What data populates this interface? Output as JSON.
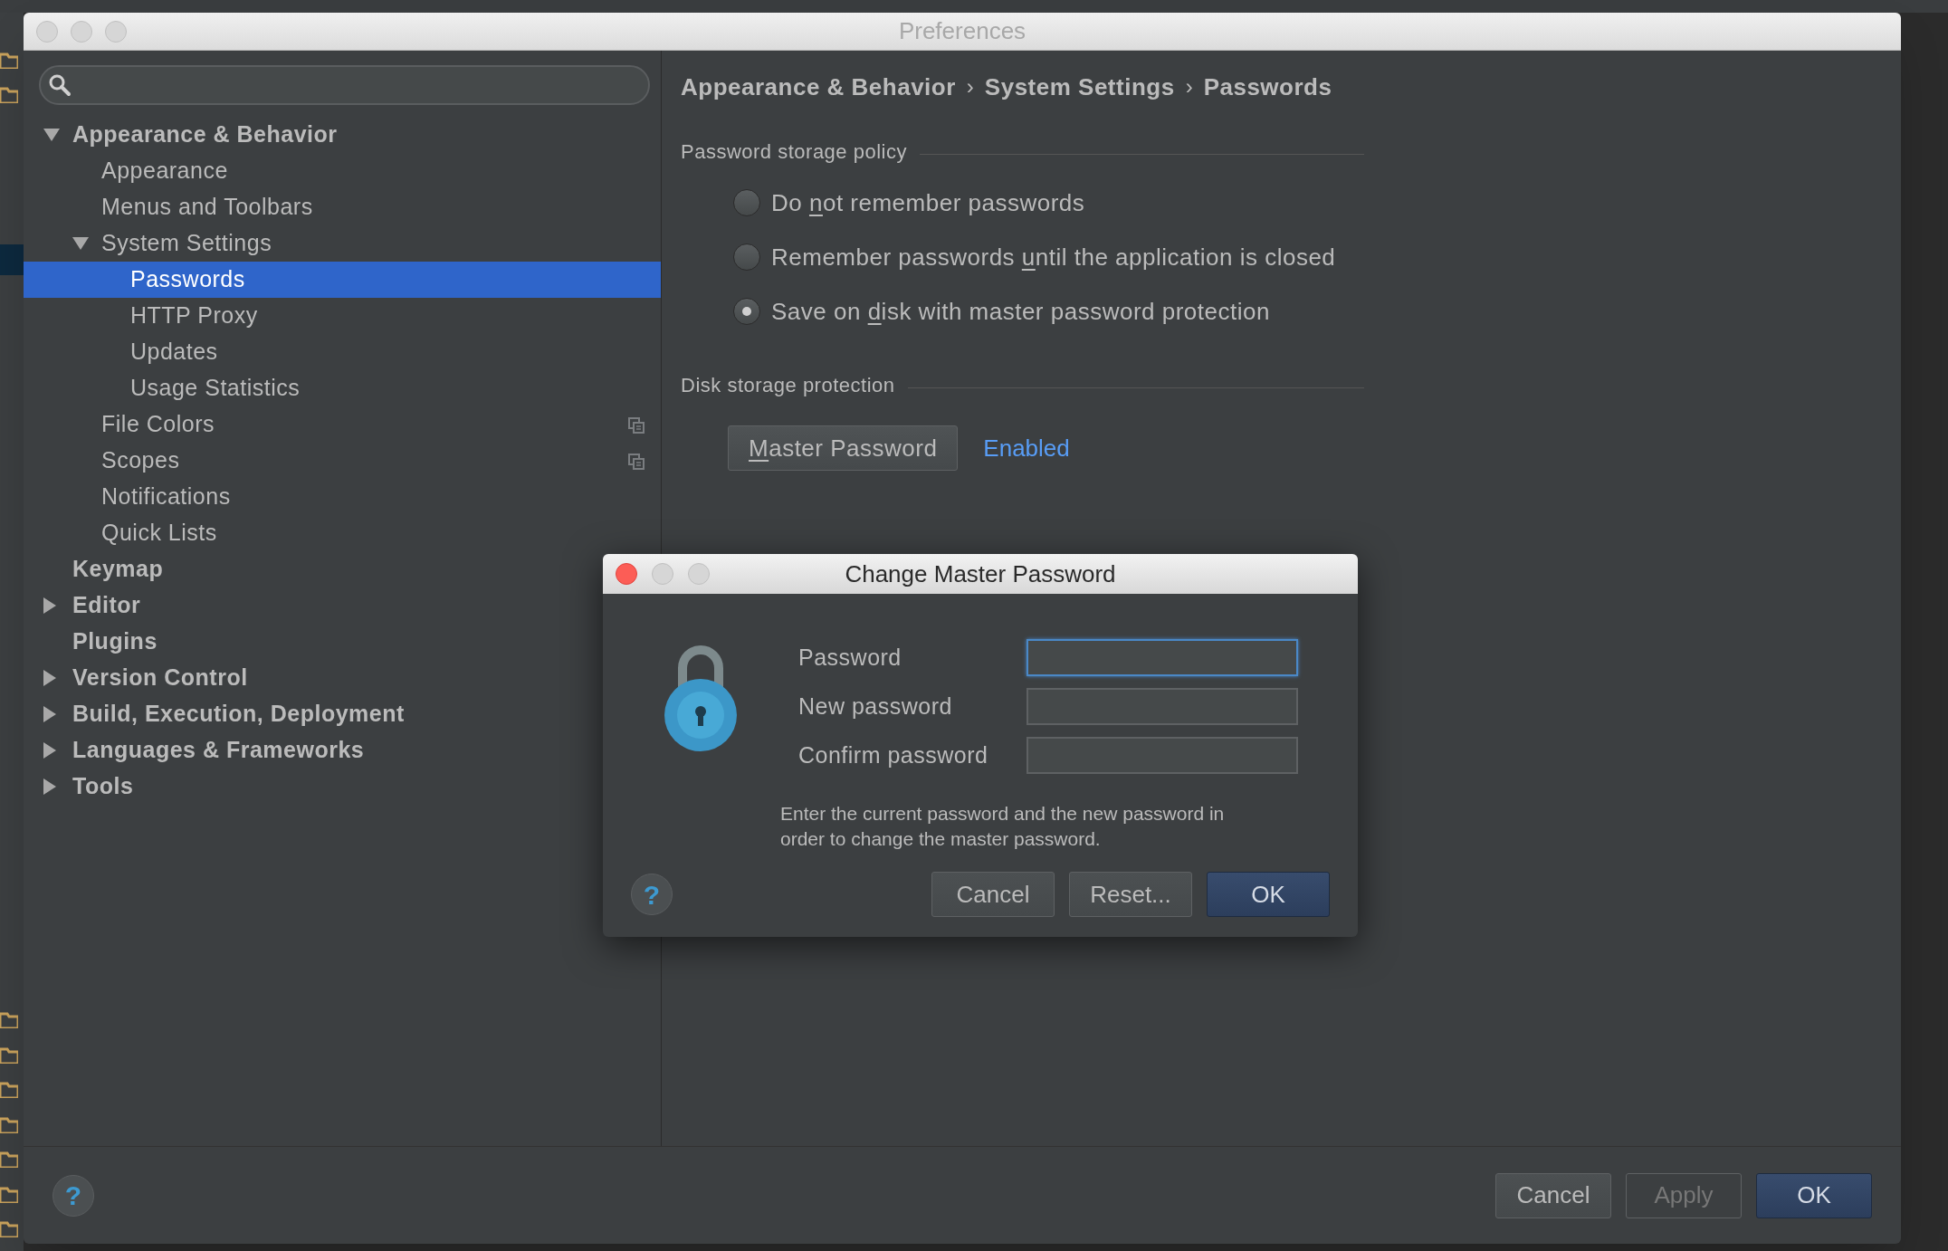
{
  "preferences_window": {
    "title": "Preferences"
  },
  "tree": [
    {
      "label": "Appearance & Behavior",
      "expanded": true,
      "selected": false,
      "children": [
        {
          "label": "Appearance",
          "selected": false
        },
        {
          "label": "Menus and Toolbars",
          "selected": false
        },
        {
          "label": "System Settings",
          "expanded": true,
          "selected": false,
          "children": [
            {
              "label": "Passwords",
              "selected": true
            },
            {
              "label": "HTTP Proxy",
              "selected": false
            },
            {
              "label": "Updates",
              "selected": false
            },
            {
              "label": "Usage Statistics",
              "selected": false
            }
          ]
        },
        {
          "label": "File Colors",
          "selected": false,
          "project_icon": true
        },
        {
          "label": "Scopes",
          "selected": false,
          "project_icon": true
        },
        {
          "label": "Notifications",
          "selected": false
        },
        {
          "label": "Quick Lists",
          "selected": false
        }
      ]
    },
    {
      "label": "Keymap",
      "selected": false
    },
    {
      "label": "Editor",
      "expanded": false,
      "selected": false
    },
    {
      "label": "Plugins",
      "selected": false
    },
    {
      "label": "Version Control",
      "expanded": false,
      "selected": false
    },
    {
      "label": "Build, Execution, Deployment",
      "expanded": false,
      "selected": false
    },
    {
      "label": "Languages & Frameworks",
      "expanded": false,
      "selected": false
    },
    {
      "label": "Tools",
      "expanded": false,
      "selected": false
    }
  ],
  "breadcrumb": {
    "items": [
      "Appearance & Behavior",
      "System Settings",
      "Passwords"
    ],
    "separator": "›"
  },
  "password_storage_policy": {
    "title": "Password storage policy",
    "options": [
      {
        "before": "Do ",
        "mnemonic": "n",
        "after": "ot remember passwords",
        "selected": false
      },
      {
        "before": "Remember passwords ",
        "mnemonic": "u",
        "after": "ntil the application is closed",
        "selected": false
      },
      {
        "before": "Save on ",
        "mnemonic": "d",
        "after": "isk with master password protection",
        "selected": true
      }
    ]
  },
  "disk_storage_protection": {
    "title": "Disk storage protection",
    "button": {
      "mnemonic": "M",
      "after": "aster Password"
    },
    "status": "Enabled"
  },
  "help_button": "?",
  "buttons": [
    {
      "label": "Cancel",
      "kind": "normal",
      "disabled": false
    },
    {
      "label": "Apply",
      "kind": "normal",
      "disabled": true
    },
    {
      "label": "OK",
      "kind": "default",
      "disabled": false
    }
  ],
  "dialog": {
    "title": "Change Master Password",
    "fields": [
      {
        "label": "Password",
        "focused": true
      },
      {
        "label": "New password",
        "focused": false
      },
      {
        "label": "Confirm password",
        "focused": false
      }
    ],
    "help_button": "?",
    "message": "Enter the current password and the new password in order to change the master password.",
    "buttons": [
      {
        "label": "Cancel",
        "kind": "normal"
      },
      {
        "label": "Reset...",
        "kind": "normal"
      },
      {
        "label": "OK",
        "kind": "default"
      }
    ]
  }
}
